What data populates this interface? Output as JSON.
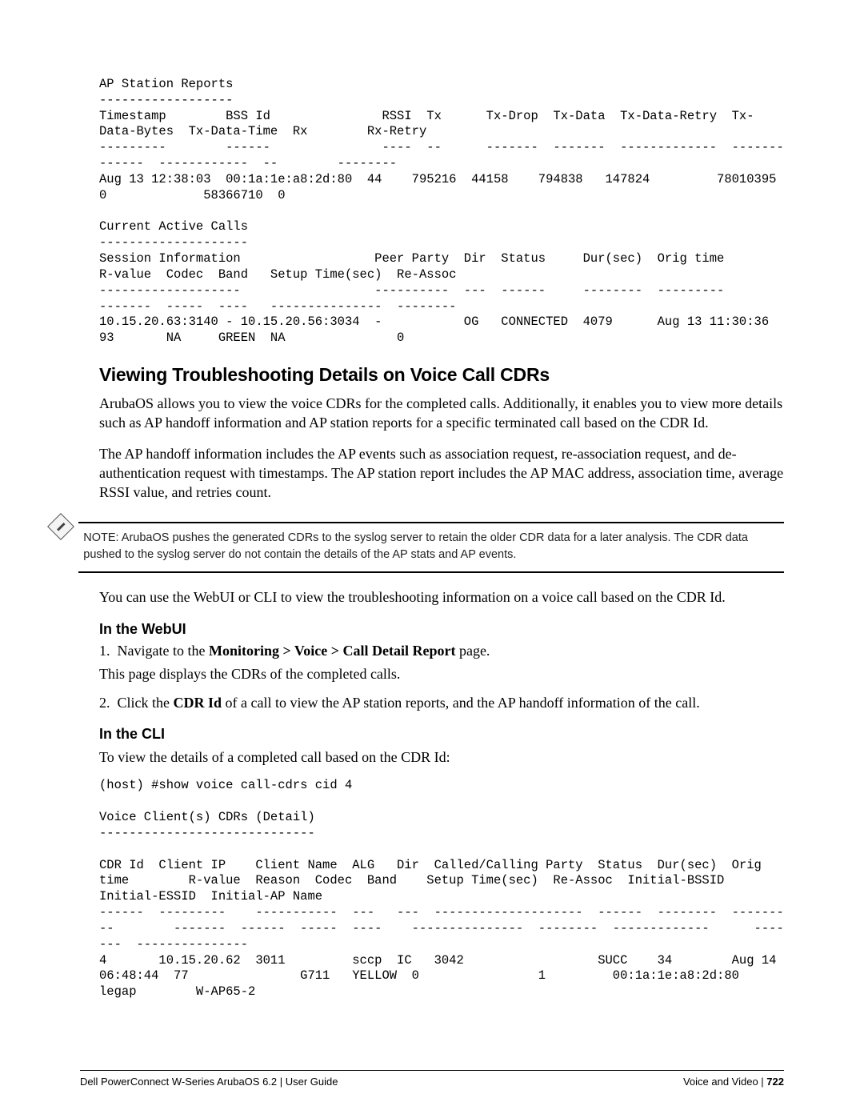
{
  "pre_top": "AP Station Reports\n------------------\nTimestamp        BSS Id               RSSI  Tx      Tx-Drop  Tx-Data  Tx-Data-Retry  Tx-Data-Bytes  Tx-Data-Time  Rx        Rx-Retry\n---------        ------               ----  --      -------  -------  -------------  -------------  ------------  --        --------\nAug 13 12:38:03  00:1a:1e:a8:2d:80  44    795216  44158    794838   147824         78010395    0             58366710  0\n\nCurrent Active Calls\n--------------------\nSession Information                  Peer Party  Dir  Status     Dur(sec)  Orig time          R-value  Codec  Band   Setup Time(sec)  Re-Assoc\n-------------------                  ----------  ---  ------     --------  ---------          -------  -----  ----   ---------------  --------\n10.15.20.63:3140 - 10.15.20.56:3034  -           OG   CONNECTED  4079      Aug 13 11:30:36    93       NA     GREEN  NA               0",
  "h2": "Viewing Troubleshooting Details on Voice Call CDRs",
  "p1": "ArubaOS allows you to view the voice CDRs for the completed calls. Additionally, it enables you to view more details such as AP handoff information and AP station reports for a specific terminated call based on the CDR Id.",
  "p2": "The AP handoff information includes the AP events such as association request, re-association request, and de-authentication request with timestamps. The AP station report includes the AP MAC address, association time, average RSSI value, and retries count.",
  "note": "NOTE: ArubaOS pushes the generated CDRs to the syslog server to retain the older CDR data for a later analysis. The CDR data pushed to the syslog server do not contain the details of the AP stats and AP events.",
  "p3": "You can use the WebUI or CLI to view the troubleshooting information on a voice call based on the CDR Id.",
  "h3a": "In the WebUI",
  "step1_pre": "Navigate to the ",
  "step1_bold": "Monitoring > Voice > Call Detail Report",
  "step1_post": " page.",
  "step1_after": "This page displays the CDRs of the completed calls.",
  "step2_pre": "Click the ",
  "step2_bold": "CDR Id",
  "step2_post": " of a call to view the AP station reports, and the AP handoff information of the call.",
  "h3b": "In the CLI",
  "p4": "To view the details of a completed call based on the CDR Id:",
  "pre_bottom": "(host) #show voice call-cdrs cid 4\n\nVoice Client(s) CDRs (Detail)\n-----------------------------\n\nCDR Id  Client IP    Client Name  ALG   Dir  Called/Calling Party  Status  Dur(sec)  Orig time        R-value  Reason  Codec  Band    Setup Time(sec)  Re-Assoc  Initial-BSSID      Initial-ESSID  Initial-AP Name\n------  ---------    -----------  ---   ---  --------------------  ------  --------  ---------        -------  ------  -----  ----    ---------------  --------  -------------      -------  ---------------\n4       10.15.20.62  3011         sccp  IC   3042                  SUCC    34        Aug 14 06:48:44  77               G711   YELLOW  0                1         00:1a:1e:a8:2d:80  legap        W-AP65-2",
  "footer_left": "Dell PowerConnect W-Series ArubaOS 6.2 | User Guide",
  "footer_right_label": "Voice and Video",
  "footer_sep": " | ",
  "footer_page": "722"
}
